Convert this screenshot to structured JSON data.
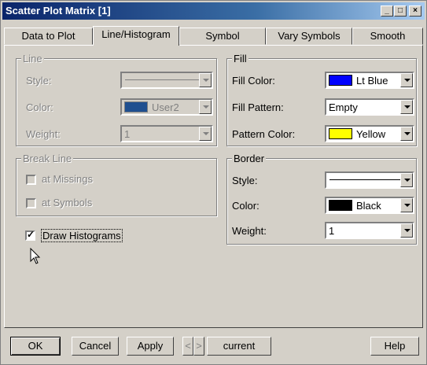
{
  "window": {
    "title": "Scatter Plot Matrix [1]"
  },
  "tabs": [
    {
      "label": "Data to Plot"
    },
    {
      "label": "Line/Histogram"
    },
    {
      "label": "Symbol"
    },
    {
      "label": "Vary Symbols"
    },
    {
      "label": "Smooth"
    }
  ],
  "line_group": {
    "legend": "Line",
    "style_label": "Style:",
    "color_label": "Color:",
    "color_value": "User2",
    "color_swatch": "#1f4f8f",
    "weight_label": "Weight:",
    "weight_value": "1"
  },
  "break_group": {
    "legend": "Break Line",
    "missings_label": "at Missings",
    "symbols_label": "at Symbols"
  },
  "draw_histograms": {
    "label": "Draw Histograms",
    "checked": true
  },
  "fill_group": {
    "legend": "Fill",
    "fill_color_label": "Fill Color:",
    "fill_color_value": "Lt Blue",
    "fill_color_swatch": "#0000ff",
    "fill_pattern_label": "Fill Pattern:",
    "fill_pattern_value": "Empty",
    "pattern_color_label": "Pattern Color:",
    "pattern_color_value": "Yellow",
    "pattern_color_swatch": "#ffff00"
  },
  "border_group": {
    "legend": "Border",
    "style_label": "Style:",
    "color_label": "Color:",
    "color_value": "Black",
    "color_swatch": "#000000",
    "weight_label": "Weight:",
    "weight_value": "1"
  },
  "footer": {
    "ok": "OK",
    "cancel": "Cancel",
    "apply": "Apply",
    "prev": "<",
    "next": ">",
    "current": "current",
    "help": "Help"
  }
}
